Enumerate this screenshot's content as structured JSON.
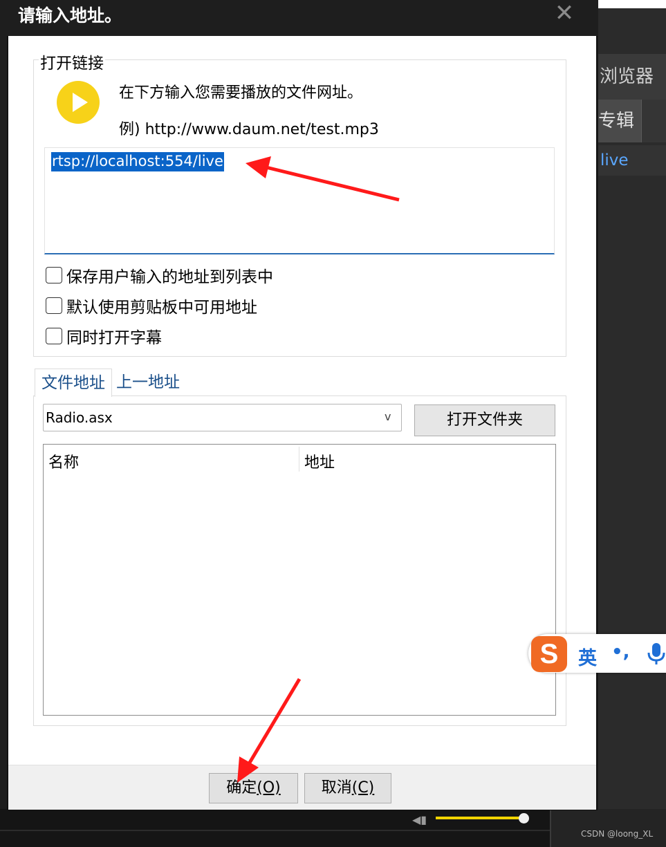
{
  "background_app": {
    "tab_browser": "浏览器",
    "tab_album": "专辑",
    "list_item": "live",
    "watermark": "CSDN @loong_XL"
  },
  "ime": {
    "logo": "S",
    "lang": "英",
    "punct": "•,"
  },
  "dialog": {
    "title": "请输入地址。",
    "close": "✕",
    "group_title": "打开链接",
    "hint_line1": "在下方输入您需要播放的文件网址。",
    "hint_line2": "例) http://www.daum.net/test.mp3",
    "url_value": "rtsp://localhost:554/live",
    "checkboxes": [
      {
        "label": "保存用户输入的地址到列表中",
        "checked": false
      },
      {
        "label": "默认使用剪贴板中可用地址",
        "checked": false
      },
      {
        "label": "同时打开字幕",
        "checked": false
      }
    ],
    "tabs": [
      {
        "label": "文件地址",
        "active": true
      },
      {
        "label": "上一地址",
        "active": false
      }
    ],
    "combo_value": "Radio.asx",
    "combo_arrow": "v",
    "open_folder_label": "打开文件夹",
    "list_columns": [
      "名称",
      "地址"
    ],
    "ok_label": "确定",
    "ok_accel": "(O)",
    "cancel_label": "取消",
    "cancel_accel": "(C)"
  },
  "colors": {
    "accent_red": "#ff1a1a",
    "play_icon": "#f7d219",
    "selection": "#0a64c8",
    "tab_text": "#1a4f8a"
  }
}
